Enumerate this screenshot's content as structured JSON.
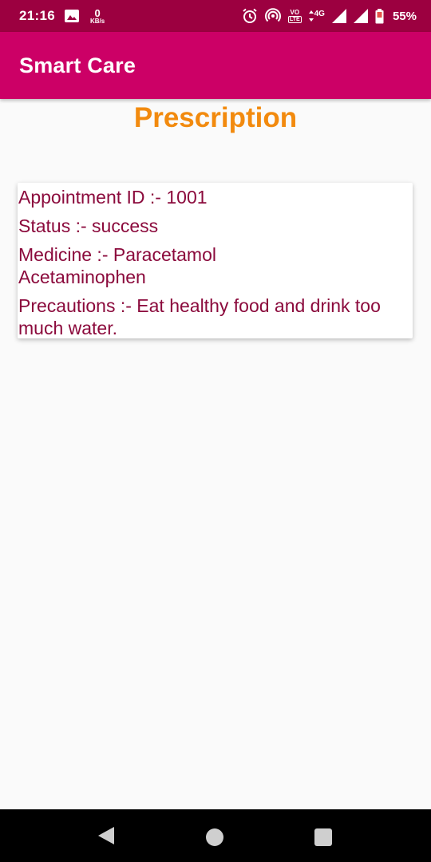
{
  "status_bar": {
    "time": "21:16",
    "speed_value": "0",
    "speed_unit": "KB/s",
    "volte_top": "VO",
    "volte_bottom": "LTE",
    "network": "4G",
    "battery": "55%",
    "icons": [
      "image-icon",
      "alarm-icon",
      "hotspot-icon",
      "volte-icon",
      "signal-icon",
      "battery-icon"
    ]
  },
  "app_bar": {
    "title": "Smart Care"
  },
  "page": {
    "heading": "Prescription"
  },
  "prescription": {
    "appointment_line": "Appointment ID :- 1001",
    "status_line": "Status :- success",
    "medicine_line_1": "Medicine :- Paracetamol",
    "medicine_line_2": "Acetaminophen",
    "precautions_line_1": "Precautions :- Eat healthy food and drink too",
    "precautions_line_2": "much water."
  },
  "nav_bar": {
    "icons": [
      "back-icon",
      "home-icon",
      "recents-icon"
    ]
  },
  "colors": {
    "status_bar": "#9c0040",
    "app_bar": "#cc0066",
    "heading": "#f28a0e",
    "card_text": "#8b0a3c",
    "background": "#fafafa"
  }
}
